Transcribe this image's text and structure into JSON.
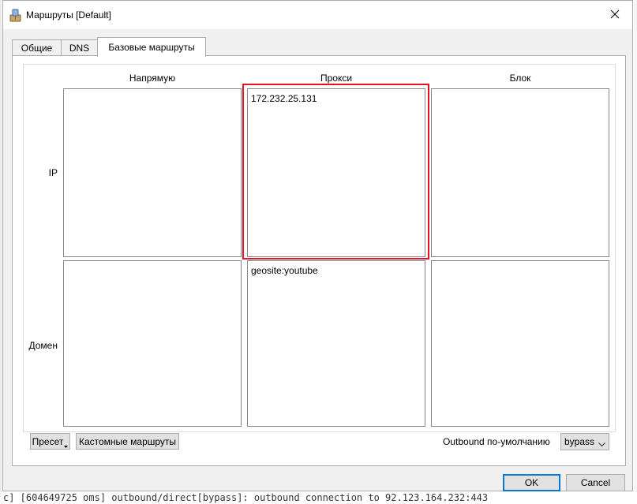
{
  "window": {
    "title": "Маршруты [Default]",
    "close_glyph": "✕"
  },
  "tabs": [
    {
      "label": "Общие",
      "active": false
    },
    {
      "label": "DNS",
      "active": false
    },
    {
      "label": "Базовые маршруты",
      "active": true
    }
  ],
  "grid": {
    "columns": [
      "Напрямую",
      "Прокси",
      "Блок"
    ],
    "rows": [
      "IP",
      "Домен"
    ],
    "cells": {
      "ip_direct": "",
      "ip_proxy": "172.232.25.131",
      "ip_block": "",
      "domain_direct": "",
      "domain_proxy": "geosite:youtube",
      "domain_block": ""
    },
    "highlight_color": "#e81123"
  },
  "bottom_bar": {
    "preset_label": "Пресет",
    "custom_routes_label": "Кастомные маршруты",
    "outbound_label": "Outbound по-умолчанию",
    "outbound_value": "bypass"
  },
  "dialog_buttons": {
    "ok": "OK",
    "cancel": "Cancel"
  },
  "background": {
    "log_line": "c] [604649725 oms] outbound/direct[bypass]: outbound connection to 92.123.164.232:443"
  },
  "colors": {
    "accent": "#0078d7",
    "window_bg": "#f0f0f0"
  }
}
